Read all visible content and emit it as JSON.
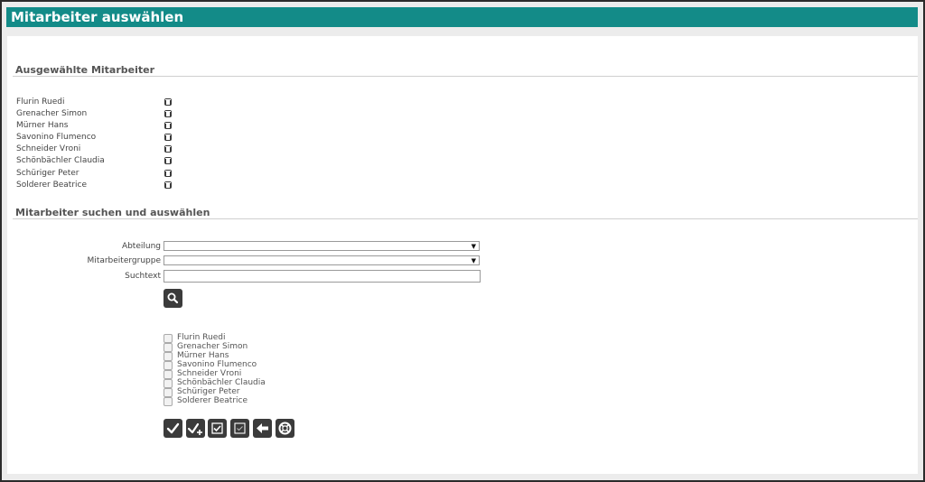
{
  "window": {
    "title": "Mitarbeiter auswählen"
  },
  "selected": {
    "heading": "Ausgewählte Mitarbeiter",
    "items": [
      {
        "name": "Flurin Ruedi"
      },
      {
        "name": "Grenacher Simon"
      },
      {
        "name": "Mürner Hans"
      },
      {
        "name": "Savonino Flumenco"
      },
      {
        "name": "Schneider Vroni"
      },
      {
        "name": "Schönbächler Claudia"
      },
      {
        "name": "Schüriger Peter"
      },
      {
        "name": "Solderer Beatrice"
      }
    ]
  },
  "search": {
    "heading": "Mitarbeiter suchen und auswählen",
    "abteilung_label": "Abteilung",
    "abteilung_value": "",
    "gruppe_label": "Mitarbeitergruppe",
    "gruppe_value": "",
    "suchtext_label": "Suchtext",
    "suchtext_value": "",
    "search_button_icon": "magnifier-icon"
  },
  "results": {
    "items": [
      {
        "name": "Flurin Ruedi",
        "checked": false
      },
      {
        "name": "Grenacher Simon",
        "checked": false
      },
      {
        "name": "Mürner Hans",
        "checked": false
      },
      {
        "name": "Savonino Flumenco",
        "checked": false
      },
      {
        "name": "Schneider Vroni",
        "checked": false
      },
      {
        "name": "Schönbächler Claudia",
        "checked": false
      },
      {
        "name": "Schüriger Peter",
        "checked": false
      },
      {
        "name": "Solderer Beatrice",
        "checked": false
      }
    ]
  },
  "actions": [
    {
      "icon": "checkmark-icon"
    },
    {
      "icon": "checkmark-plus-icon"
    },
    {
      "icon": "select-all-icon"
    },
    {
      "icon": "deselect-all-icon"
    },
    {
      "icon": "back-arrow-icon"
    },
    {
      "icon": "lifebuoy-icon"
    }
  ],
  "colors": {
    "titlebar": "#138b88",
    "button": "#3b3b3b"
  }
}
